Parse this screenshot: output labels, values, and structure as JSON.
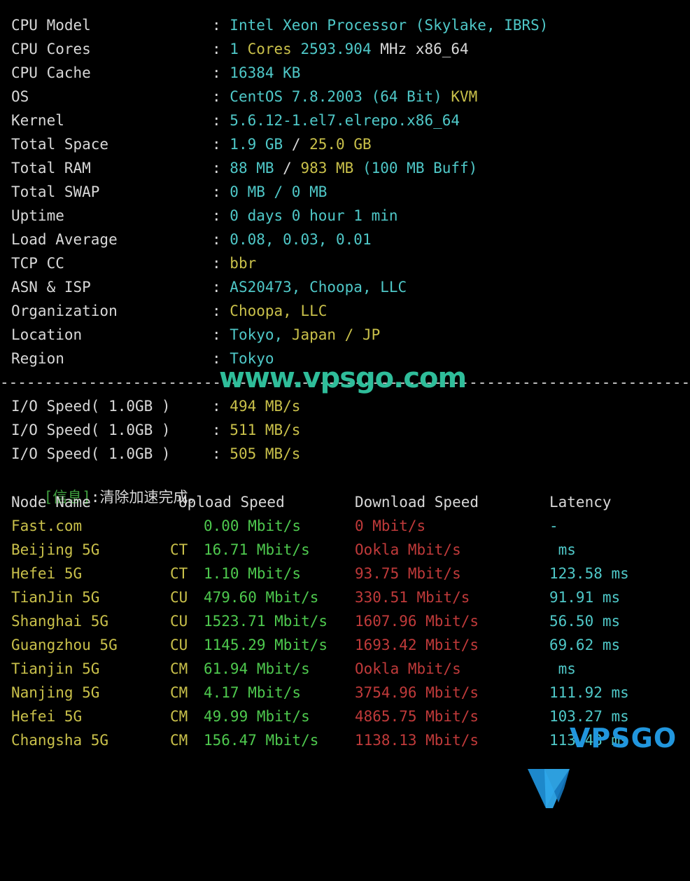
{
  "separator": "-----------------------------------------------------------------------------------------",
  "sysinfo": {
    "rows": [
      {
        "label": "CPU Model",
        "colon": ":",
        "parts": [
          {
            "t": "Intel Xeon Processor (Skylake, IBRS)",
            "c": "cyan"
          }
        ]
      },
      {
        "label": "CPU Cores",
        "colon": ":",
        "parts": [
          {
            "t": "1 ",
            "c": "cyan"
          },
          {
            "t": "Cores ",
            "c": "yellow"
          },
          {
            "t": "2593.904 ",
            "c": "cyan"
          },
          {
            "t": "MHz ",
            "c": "white"
          },
          {
            "t": "x86_64",
            "c": "white"
          }
        ]
      },
      {
        "label": "CPU Cache",
        "colon": ":",
        "parts": [
          {
            "t": "16384 KB",
            "c": "cyan"
          }
        ]
      },
      {
        "label": "OS",
        "colon": ":",
        "parts": [
          {
            "t": "CentOS 7.8.2003 (64 Bit) ",
            "c": "cyan"
          },
          {
            "t": "KVM",
            "c": "yellow"
          }
        ]
      },
      {
        "label": "Kernel",
        "colon": ":",
        "parts": [
          {
            "t": "5.6.12-1.el7.elrepo.x86_64",
            "c": "cyan"
          }
        ]
      },
      {
        "label": "Total Space",
        "colon": ":",
        "parts": [
          {
            "t": "1.9 GB ",
            "c": "cyan"
          },
          {
            "t": "/ ",
            "c": "white"
          },
          {
            "t": "25.0 GB",
            "c": "yellow"
          }
        ]
      },
      {
        "label": "Total RAM",
        "colon": ":",
        "parts": [
          {
            "t": "88 MB ",
            "c": "cyan"
          },
          {
            "t": "/ ",
            "c": "white"
          },
          {
            "t": "983 MB ",
            "c": "yellow"
          },
          {
            "t": "(100 MB Buff)",
            "c": "cyan"
          }
        ]
      },
      {
        "label": "Total SWAP",
        "colon": ":",
        "parts": [
          {
            "t": "0 MB / 0 MB",
            "c": "cyan"
          }
        ]
      },
      {
        "label": "Uptime",
        "colon": ":",
        "parts": [
          {
            "t": "0 days 0 hour 1 min",
            "c": "cyan"
          }
        ]
      },
      {
        "label": "Load Average",
        "colon": ":",
        "parts": [
          {
            "t": "0.08, 0.03, 0.01",
            "c": "cyan"
          }
        ]
      },
      {
        "label": "TCP CC",
        "colon": ":",
        "parts": [
          {
            "t": "bbr",
            "c": "yellow"
          }
        ]
      },
      {
        "label": "ASN & ISP",
        "colon": ":",
        "parts": [
          {
            "t": "AS20473, Choopa, LLC",
            "c": "cyan"
          }
        ]
      },
      {
        "label": "Organization",
        "colon": ":",
        "parts": [
          {
            "t": "Choopa, LLC",
            "c": "yellow"
          }
        ]
      },
      {
        "label": "Location",
        "colon": ":",
        "parts": [
          {
            "t": "Tokyo, ",
            "c": "cyan"
          },
          {
            "t": "Japan / JP",
            "c": "yellow"
          }
        ]
      },
      {
        "label": "Region",
        "colon": ":",
        "parts": [
          {
            "t": "Tokyo",
            "c": "cyan"
          }
        ]
      }
    ]
  },
  "io": {
    "rows": [
      {
        "label": "I/O Speed( 1.0GB )",
        "colon": ":",
        "value": "494 MB/s"
      },
      {
        "label": "I/O Speed( 1.0GB )",
        "colon": ":",
        "value": "511 MB/s"
      },
      {
        "label": "I/O Speed( 1.0GB )",
        "colon": ":",
        "value": "505 MB/s"
      }
    ]
  },
  "notice": {
    "bracket": "[信息]",
    "message": ":清除加速完成。"
  },
  "speedtest": {
    "headers": {
      "node": "Node Name",
      "isp": "",
      "upload": "Upload Speed",
      "download": "Download Speed",
      "latency": "Latency"
    },
    "rows": [
      {
        "node": "Fast.com",
        "isp": "",
        "upload": "0.00 Mbit/s",
        "download": "0 Mbit/s",
        "latency": "-"
      },
      {
        "node": "Beijing 5G",
        "isp": "CT",
        "upload": "16.71 Mbit/s",
        "download": "Ookla Mbit/s",
        "latency": " ms"
      },
      {
        "node": "Hefei 5G",
        "isp": "CT",
        "upload": "1.10 Mbit/s",
        "download": "93.75 Mbit/s",
        "latency": "123.58 ms"
      },
      {
        "node": "TianJin 5G",
        "isp": "CU",
        "upload": "479.60 Mbit/s",
        "download": "330.51 Mbit/s",
        "latency": "91.91 ms"
      },
      {
        "node": "Shanghai 5G",
        "isp": "CU",
        "upload": "1523.71 Mbit/s",
        "download": "1607.96 Mbit/s",
        "latency": "56.50 ms"
      },
      {
        "node": "Guangzhou 5G",
        "isp": "CU",
        "upload": "1145.29 Mbit/s",
        "download": "1693.42 Mbit/s",
        "latency": "69.62 ms"
      },
      {
        "node": "Tianjin 5G",
        "isp": "CM",
        "upload": "61.94 Mbit/s",
        "download": "Ookla Mbit/s",
        "latency": " ms"
      },
      {
        "node": "Nanjing 5G",
        "isp": "CM",
        "upload": "4.17 Mbit/s",
        "download": "3754.96 Mbit/s",
        "latency": "111.92 ms"
      },
      {
        "node": "Hefei 5G",
        "isp": "CM",
        "upload": "49.99 Mbit/s",
        "download": "4865.75 Mbit/s",
        "latency": "103.27 ms"
      },
      {
        "node": "Changsha 5G",
        "isp": "CM",
        "upload": "156.47 Mbit/s",
        "download": "1138.13 Mbit/s",
        "latency": "113.43 ms"
      }
    ]
  },
  "watermarks": {
    "site": "www.vpsgo.com",
    "logo_word": "VPSGO"
  },
  "colors": {
    "background": "#000000",
    "foreground": "#d8d8d8",
    "cyan": "#4fc8c8",
    "yellow": "#c9c04a",
    "green": "#4ec94e",
    "red": "#c03a3a",
    "notice_bracket": "#3fa03f",
    "watermark_site": "#2fbd9a",
    "watermark_logo": "#2196dd"
  }
}
